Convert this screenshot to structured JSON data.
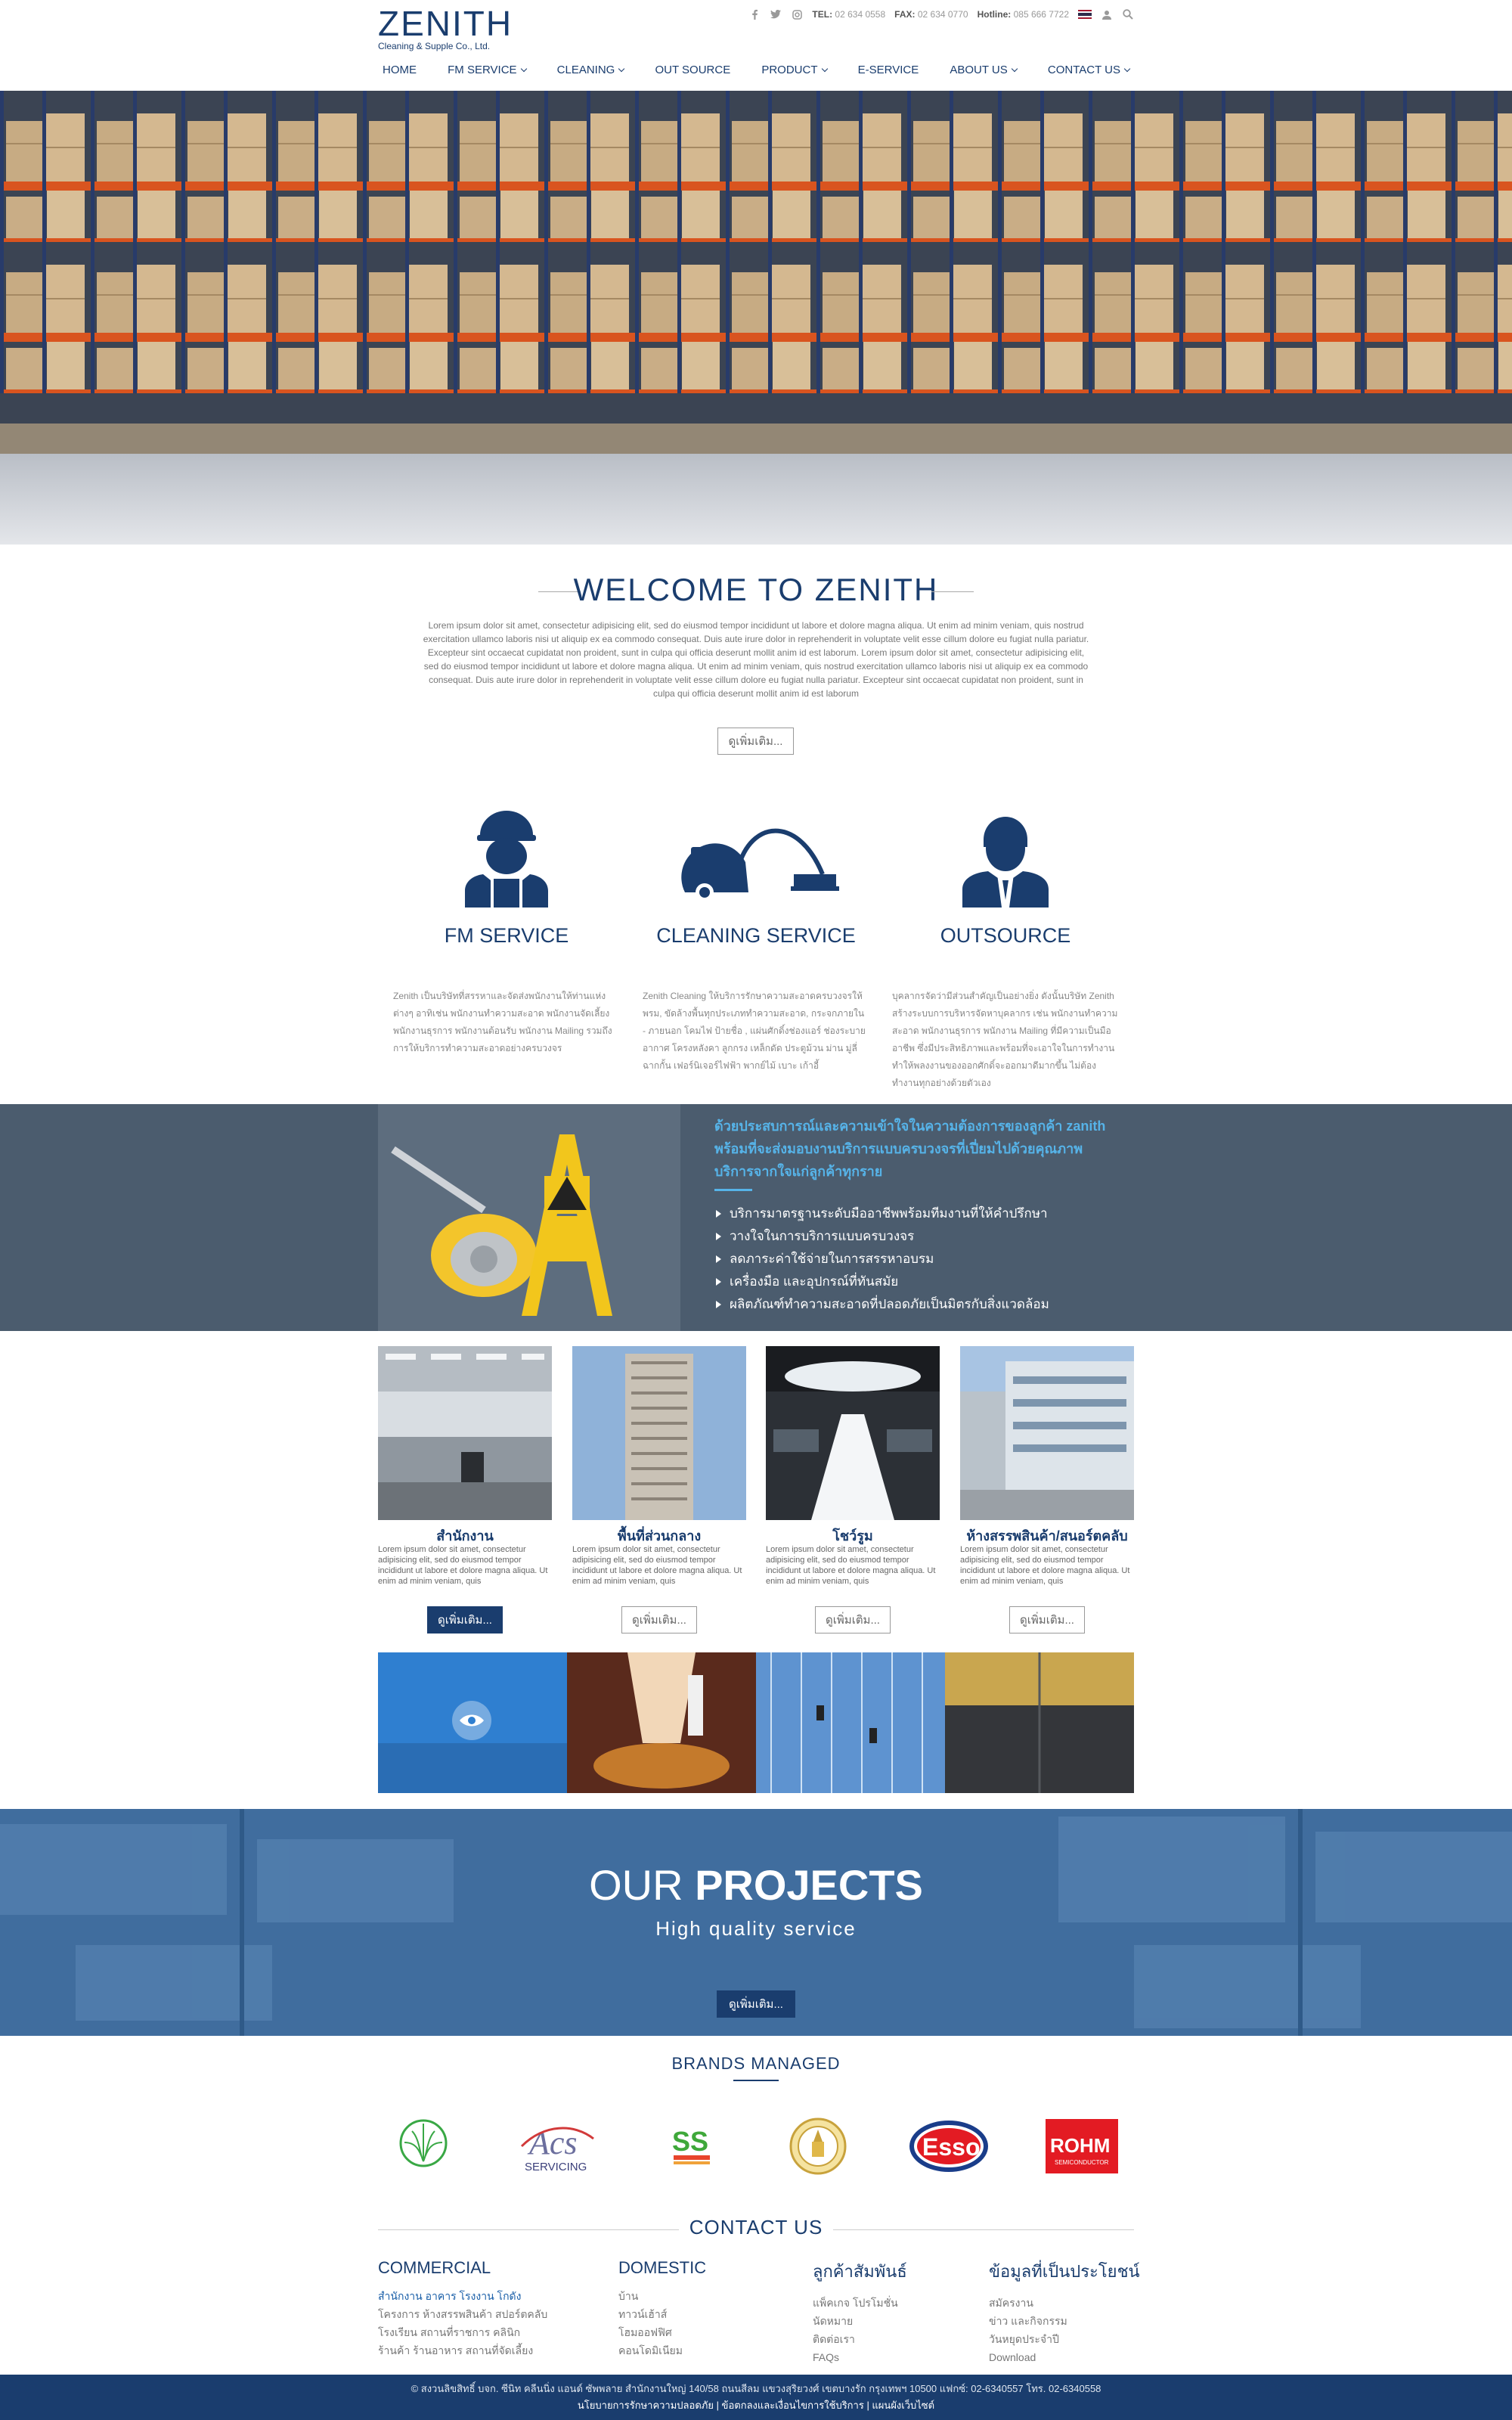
{
  "header": {
    "logo_main": "ZENITH",
    "logo_sub": "Cleaning & Supple Co., Ltd.",
    "tel_label": "TEL:",
    "tel": "02 634 0558",
    "fax_label": "FAX:",
    "fax": "02 634 0770",
    "hotline_label": "Hotline:",
    "hotline": "085 666 7722"
  },
  "nav": [
    "HOME",
    "FM SERVICE",
    "CLEANING",
    "OUT SOURCE",
    "PRODUCT",
    "E-SERVICE",
    "ABOUT US",
    "CONTACT US"
  ],
  "welcome": {
    "title": "WELCOME TO ZENITH",
    "text": "Lorem ipsum dolor sit amet, consectetur adipisicing elit, sed do eiusmod tempor incididunt ut labore et dolore magna aliqua. Ut enim ad minim veniam, quis nostrud exercitation ullamco laboris nisi ut aliquip ex ea commodo consequat. Duis aute irure dolor in reprehenderit in voluptate velit esse cillum dolore eu fugiat nulla pariatur. Excepteur sint occaecat cupidatat non proident, sunt in culpa qui officia deserunt mollit anim id est laborum. Lorem ipsum dolor sit amet, consectetur adipisicing elit, sed do eiusmod tempor incididunt ut labore et dolore magna aliqua. Ut enim ad minim veniam, quis nostrud exercitation ullamco laboris nisi ut aliquip ex ea commodo consequat. Duis aute irure dolor in reprehenderit in voluptate velit esse cillum dolore eu fugiat nulla pariatur. Excepteur sint occaecat cupidatat non proident, sunt in culpa qui officia deserunt mollit anim id est laborum",
    "button": "ดูเพิ่มเติม..."
  },
  "services": [
    {
      "title": "FM SERVICE",
      "text": "Zenith เป็นบริษัทที่สรรหาและจัดส่งพนักงานให้ท่านแห่งต่างๆ อาทิเช่น พนักงานทำความสะอาด พนักงานจัดเลี้ยง พนักงานธุรการ พนักงานต้อนรับ พนักงาน Mailing รวมถึงการให้บริการทำความสะอาดอย่างครบวงจร"
    },
    {
      "title": "CLEANING SERVICE",
      "text": "Zenith Cleaning ให้บริการรักษาความสะอาดครบวงจรให้พรม, ขัดล้างพื้นทุกประเภททำความสะอาด, กระจกภายใน - ภายนอก โคมไฟ ป้ายชื่อ , แผ่นศักดิ์งช่องแอร์ ช่องระบายอากาศ โครงหลังคา ลูกกรง เหล็กดัด ประตูม้วน ม่าน มู่ลี่ ฉากกั้น เฟอร์นิเจอร์ไฟฟ้า พากย์ไม้ เบาะ เก้าอี้"
    },
    {
      "title": "OUTSOURCE",
      "text": "บุคลากรจัดว่ามีส่วนสำคัญเป็นอย่างยิ่ง ดังนั้นบริษัท Zenith สร้างระบบการบริหารจัดหาบุคลากร เช่น พนักงานทำความสะอาด พนักงานธุรการ พนักงาน Mailing ที่มีความเป็นมืออาชีพ ซึ่งมีประสิทธิภาพและพร้อมที่จะเอาใจในการทำงาน ทำให้พลงงานของออกศักดิ์จะออกมาดีมากขึ้น ไม่ต้องทำงานทุกอย่างด้วยตัวเอง"
    }
  ],
  "band": {
    "headline": "ด้วยประสบการณ์และความเข้าใจในความต้องการของลูกค้า zanith พร้อมที่จะส่งมอบงานบริการแบบครบวงจรที่เปี่ยมไปด้วยคุณภาพ บริการจากใจแก่ลูกค้าทุกราย",
    "items": [
      "บริการมาตรฐานระดับมืออาชีพพร้อมทีมงานที่ให้คำปรึกษา",
      "วางใจในการบริการแบบครบวงจร",
      "ลดภาระค่าใช้จ่ายในการสรรหาอบรม",
      "เครื่องมือ และอุปกรณ์ที่ทันสมัย",
      "ผลิตภัณฑ์ทำความสะอาดที่ปลอดภัยเป็นมิตรกับสิ่งแวดล้อม"
    ]
  },
  "cards": [
    {
      "title": "สำนักงาน",
      "text": "Lorem ipsum dolor sit amet, consectetur adipisicing elit, sed do eiusmod tempor incididunt ut labore et dolore magna aliqua. Ut enim ad minim veniam, quis",
      "button": "ดูเพิ่มเติม..."
    },
    {
      "title": "พื้นที่ส่วนกลาง",
      "text": "Lorem ipsum dolor sit amet, consectetur adipisicing elit, sed do eiusmod tempor incididunt ut labore et dolore magna aliqua. Ut enim ad minim veniam, quis",
      "button": "ดูเพิ่มเติม..."
    },
    {
      "title": "โชว์รูม",
      "text": "Lorem ipsum dolor sit amet, consectetur adipisicing elit, sed do eiusmod tempor incididunt ut labore et dolore magna aliqua. Ut enim ad minim veniam, quis",
      "button": "ดูเพิ่มเติม..."
    },
    {
      "title": "ห้างสรรพสินค้า/สนอร์ตคลับ",
      "text": "Lorem ipsum dolor sit amet, consectetur adipisicing elit, sed do eiusmod tempor incididunt ut labore et dolore magna aliqua. Ut enim ad minim veniam, quis",
      "button": "ดูเพิ่มเติม..."
    }
  ],
  "projects": {
    "title_light": "OUR ",
    "title_bold": "PROJECTS",
    "subtitle": "High quality service",
    "button": "ดูเพิ่มเติม..."
  },
  "brands": {
    "title": "BRANDS MANAGED",
    "logos": [
      "green-leaf-logo",
      "acs-servicing-logo",
      "ss-logo",
      "seal-emblem-logo",
      "esso-logo",
      "rohm-logo"
    ],
    "acs_text": "SERVICING",
    "esso_text": "Esso",
    "rohm_text": "ROHM",
    "rohm_sub": "SEMICONDUCTOR"
  },
  "contact": {
    "title": "CONTACT US",
    "columns": [
      {
        "head": "COMMERCIAL",
        "items": [
          "สำนักงาน อาคาร โรงงาน โกดัง",
          "โครงการ ห้างสรรพสินค้า สปอร์ตคลับ",
          "โรงเรียน สถานที่ราชการ คลินิก",
          "ร้านค้า ร้านอาหาร สถานที่จัดเลี้ยง"
        ]
      },
      {
        "head": "DOMESTIC",
        "items": [
          "บ้าน",
          "ทาวน์เฮ้าส์",
          "โฮมออฟฟิศ",
          "คอนโดมิเนียม"
        ]
      },
      {
        "head": "ลูกค้าสัมพันธ์",
        "items": [
          "แพ็คเกจ โปรโมชั่น",
          "นัดหมาย",
          "ติดต่อเรา",
          "FAQs"
        ]
      },
      {
        "head": "ข้อมูลที่เป็นประโยชน์",
        "items": [
          "สมัครงาน",
          "ข่าว และกิจกรรม",
          "วันหยุดประจำปี",
          "Download"
        ]
      }
    ]
  },
  "footer": {
    "line1": "© สงวนลิขสิทธิ์ บจก. ซีนิท คลีนนิ่ง แอนด์ ซัพพลาย สำนักงานใหญ่ 140/58 ถนนสีลม แขวงสุริยวงศ์ เขตบางรัก กรุงเทพฯ 10500 แฟกซ์: 02-6340557 โทร. 02-6340558",
    "line2": "นโยบายการรักษาความปลอดภัย | ข้อตกลงและเงื่อนไขการใช้บริการ | แผนผังเว็บไซต์"
  },
  "colors": {
    "brand": "#1a3d6e",
    "accent": "#56b3e8",
    "band": "#4b5c6e",
    "projects": "#3f6b9b"
  }
}
